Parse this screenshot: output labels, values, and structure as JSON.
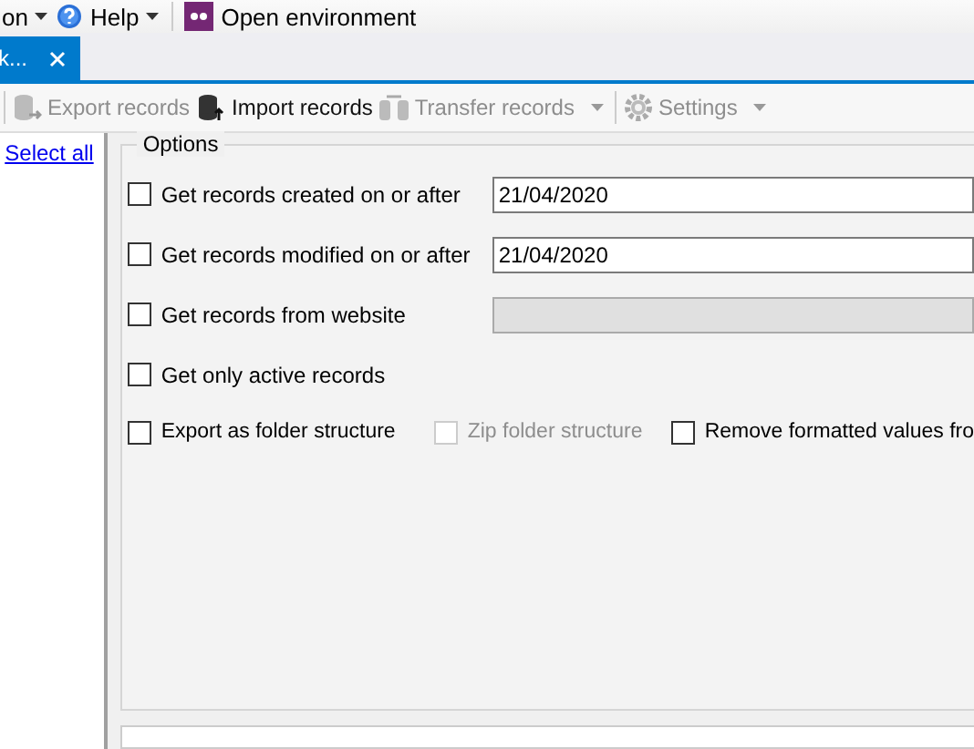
{
  "menu": [
    {
      "label": "on",
      "kind": "dropdown"
    },
    {
      "label": "Help",
      "kind": "help"
    },
    {
      "label": "Open environment",
      "kind": "environment"
    }
  ],
  "tabs": [
    {
      "label": "k...",
      "selected": true
    }
  ],
  "toolbar": [
    {
      "label": "Export records",
      "kind": "export",
      "disabled": true,
      "dropdown": false
    },
    {
      "label": "Import records",
      "kind": "import",
      "disabled": false,
      "dropdown": false
    },
    {
      "label": "Transfer records",
      "kind": "transfer",
      "disabled": true,
      "dropdown": true
    },
    {
      "label": "Settings",
      "kind": "settings",
      "disabled": true,
      "dropdown": true
    }
  ],
  "sidebar": {
    "select_all": "Select all"
  },
  "options": {
    "title": "Options",
    "rows": [
      {
        "label": "Get records created on or after",
        "checked": false,
        "field": {
          "value": "21/04/2020",
          "disabled": false
        }
      },
      {
        "label": "Get records modified on or after",
        "checked": false,
        "field": {
          "value": "21/04/2020",
          "disabled": false
        }
      },
      {
        "label": "Get records from website",
        "checked": false,
        "field": {
          "disabled": true
        }
      },
      {
        "label": "Get only active records",
        "checked": false
      }
    ],
    "last_row": [
      {
        "label": "Export as folder structure",
        "checked": false,
        "disabled": false
      },
      {
        "label": "Zip folder structure",
        "checked": false,
        "disabled": true
      },
      {
        "label": "Remove formatted values fro",
        "checked": false,
        "disabled": false
      }
    ]
  }
}
